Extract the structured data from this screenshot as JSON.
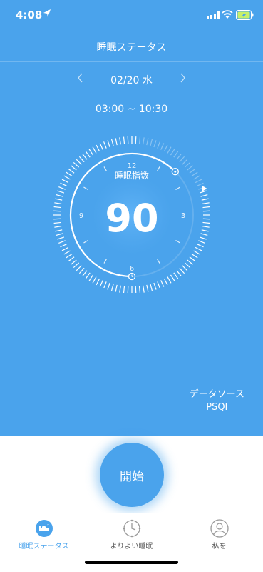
{
  "status": {
    "time": "4:08"
  },
  "nav": {
    "title": "睡眠ステータス"
  },
  "date": {
    "label": "02/20 水"
  },
  "time_range": "03:00 ~ 10:30",
  "dial": {
    "label": "睡眠指数",
    "score": "90",
    "hours": {
      "h12": "12",
      "h3": "3",
      "h6": "6",
      "h9": "9"
    }
  },
  "source": {
    "line1": "データソース",
    "line2": "PSQI"
  },
  "start_button": "開始",
  "tabs": [
    {
      "label": "睡眠ステータス",
      "icon": "bed-icon",
      "active": true
    },
    {
      "label": "よりよい睡眠",
      "icon": "clock-icon",
      "active": false
    },
    {
      "label": "私を",
      "icon": "profile-icon",
      "active": false
    }
  ],
  "colors": {
    "primary": "#4aa3ec",
    "white": "#ffffff"
  }
}
